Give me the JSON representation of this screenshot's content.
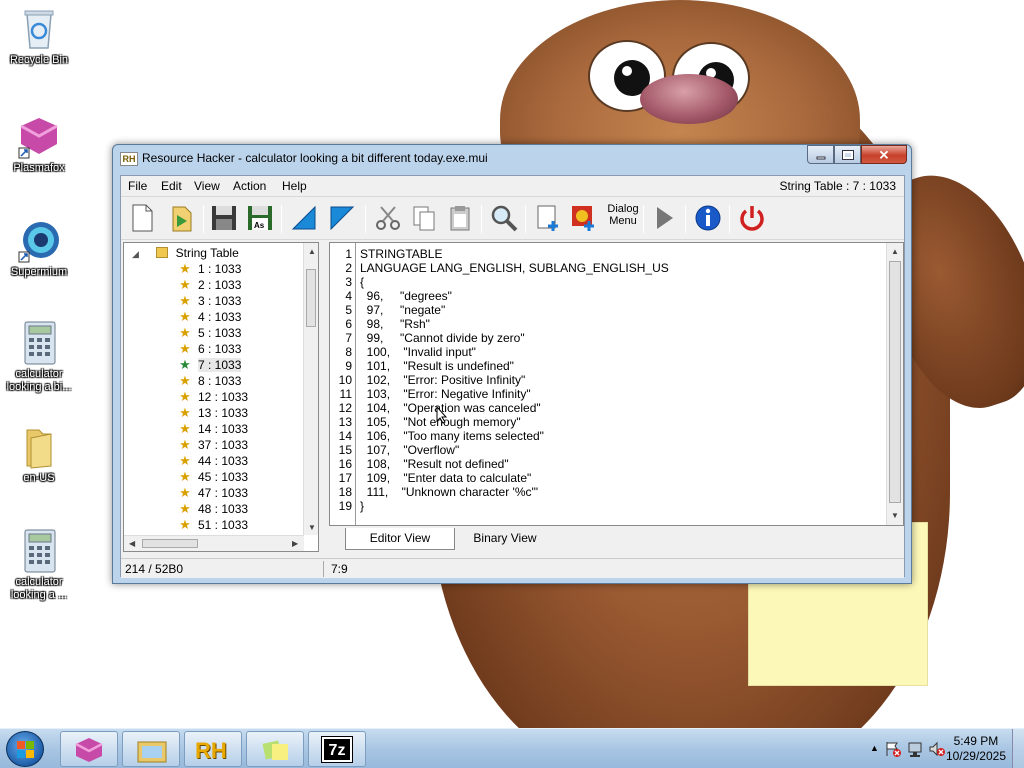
{
  "desktop": {
    "icons": [
      {
        "label": "Recycle Bin"
      },
      {
        "label": "Plasmafox"
      },
      {
        "label": "Supermium"
      },
      {
        "label": "calculator looking a bi..."
      },
      {
        "label": "en-US"
      },
      {
        "label": "calculator looking a ..."
      }
    ]
  },
  "window": {
    "title": "Resource Hacker - calculator looking a bit different today.exe.mui",
    "app_badge": "RH",
    "menu": [
      "File",
      "Edit",
      "View",
      "Action",
      "Help"
    ],
    "menu_right": "String Table : 7 : 1033",
    "toolbar": {
      "dialog_menu_line1": "Dialog",
      "dialog_menu_line2": "Menu"
    },
    "tree": {
      "root": "String Table",
      "items": [
        "1 : 1033",
        "2 : 1033",
        "3 : 1033",
        "4 : 1033",
        "5 : 1033",
        "6 : 1033",
        "7 : 1033",
        "8 : 1033",
        "12 : 1033",
        "13 : 1033",
        "14 : 1033",
        "37 : 1033",
        "44 : 1033",
        "45 : 1033",
        "47 : 1033",
        "48 : 1033",
        "51 : 1033"
      ],
      "selected": "7 : 1033"
    },
    "editor": {
      "lines": [
        "STRINGTABLE",
        "LANGUAGE LANG_ENGLISH, SUBLANG_ENGLISH_US",
        "{",
        "  96,     \"degrees\"",
        "  97,     \"negate\"",
        "  98,     \"Rsh\"",
        "  99,     \"Cannot divide by zero\"",
        "  100,    \"Invalid input\"",
        "  101,    \"Result is undefined\"",
        "  102,    \"Error: Positive Infinity\"",
        "  103,    \"Error: Negative Infinity\"",
        "  104,    \"Operation was canceled\"",
        "  105,    \"Not enough memory\"",
        "  106,    \"Too many items selected\"",
        "  107,    \"Overflow\"",
        "  108,    \"Result not defined\"",
        "  109,    \"Enter data to calculate\"",
        "  111,    \"Unknown character '%c'\"",
        "}"
      ]
    },
    "tabs": [
      "Editor View",
      "Binary View"
    ],
    "status": {
      "left": "214 / 52B0",
      "right": "7:9"
    }
  },
  "taskbar": {
    "rh_badge": "RH",
    "sevenzip_badge": "7z",
    "time": "5:49 PM",
    "date": "10/29/2025"
  },
  "colors": {
    "accent_start": "#1e5ea8",
    "close_button": "#c8402a",
    "sticky_note": "#fcf8b8"
  }
}
